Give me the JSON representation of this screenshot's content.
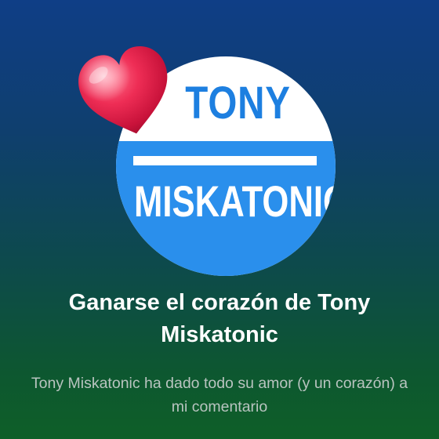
{
  "badge": {
    "name_top": "TONY",
    "name_bottom": "MISKATONIC",
    "icon": "heart-icon",
    "colors": {
      "badge_blue": "#2a8fec",
      "text_blue": "#1d7fe0",
      "badge_white": "#ffffff",
      "heart_red": "#e8284e"
    }
  },
  "achievement": {
    "title": "Ganarse el corazón de Tony Miskatonic",
    "description": "Tony Miskatonic ha dado todo su amor (y un corazón) a mi comentario"
  },
  "background": {
    "gradient_top": "#0f3e86",
    "gradient_bottom": "#0e5f28"
  }
}
